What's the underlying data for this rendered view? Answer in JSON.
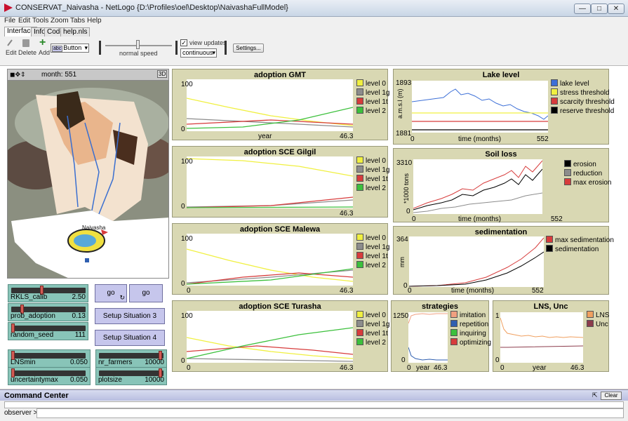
{
  "window": {
    "title": "CONSERVAT_Naivasha - NetLogo {D:\\Profiles\\oel\\Desktop\\NaivashaFullModel}"
  },
  "menu": [
    "File",
    "Edit",
    "Tools",
    "Zoom",
    "Tabs",
    "Help"
  ],
  "tabs": [
    "Interface",
    "Info",
    "Code",
    "help.nls"
  ],
  "toolbar": {
    "edit": "Edit",
    "delete": "Delete",
    "add": "Add",
    "widget": "Button",
    "speed": "normal speed",
    "view_updates": "view updates",
    "update_mode": "continuous",
    "settings": "Settings..."
  },
  "world": {
    "tick_label": "month: 551",
    "three_d": "3D",
    "place": "Naivasha"
  },
  "sliders": [
    {
      "name": "RKLS_calib",
      "value": "2.50",
      "fraction": 0.41
    },
    {
      "name": "prob_adoption",
      "value": "0.13",
      "fraction": 0.13
    },
    {
      "name": "random_seed",
      "value": "111",
      "fraction": 0.0
    },
    {
      "name": "LNSmin",
      "value": "0.050",
      "fraction": 0.0
    },
    {
      "name": "uncertaintymax",
      "value": "0.050",
      "fraction": 0.0
    },
    {
      "name": "nr_farmers",
      "value": "10000",
      "fraction": 0.98
    },
    {
      "name": "plotsize",
      "value": "10000",
      "fraction": 0.98
    }
  ],
  "buttons": {
    "go1": "go",
    "go2": "go",
    "setup3": "Setup Situation 3",
    "setup4": "Setup Situation 4"
  },
  "colors": {
    "l0": "#f0f040",
    "l1g": "#8c8c8c",
    "l1t": "#d73c3c",
    "l2": "#3cc03c",
    "lake": "#3c6fd7",
    "stress": "#f0f040",
    "scarcity": "#d73c3c",
    "reserve": "#000000",
    "erosion": "#000000",
    "reduction": "#8c8c8c",
    "max_erosion": "#d73c3c",
    "max_sed": "#d73c3c",
    "sed": "#000000",
    "imitation": "#f0a080",
    "repetition": "#2f5fb0",
    "inquiring": "#3cc03c",
    "optimizing": "#d73c3c",
    "lns": "#f0a060",
    "unc": "#8c3c4c"
  },
  "adoption": [
    {
      "title": "adoption GMT",
      "ymax": "100",
      "ymin": "0",
      "xmin": "",
      "xlabel": "year",
      "xmax": "46.3"
    },
    {
      "title": "adoption SCE Gilgil",
      "ymax": "100",
      "ymin": "0",
      "xmin": "",
      "xlabel": "",
      "xmax": "46.3"
    },
    {
      "title": "adoption SCE Malewa",
      "ymax": "100",
      "ymin": "0",
      "xmin": "0",
      "xlabel": "",
      "xmax": "46.3"
    },
    {
      "title": "adoption SCE Turasha",
      "ymax": "100",
      "ymin": "0",
      "xmin": "0",
      "xlabel": "",
      "xmax": "46.3"
    }
  ],
  "adoption_legend": [
    "level 0",
    "level 1g",
    "level 1t",
    "level 2"
  ],
  "lake": {
    "title": "Lake level",
    "ymax": "1893",
    "ymin": "1881",
    "ylabel": "a.m.s.l (m)",
    "xmin": "0",
    "xlabel": "time (months)",
    "xmax": "552",
    "legend": [
      "lake level",
      "stress threshold",
      "scarcity threshold",
      "reserve threshold"
    ]
  },
  "soil": {
    "title": "Soil loss",
    "ymax": "3310",
    "ymin": "0",
    "ylabel": "*1000 tons",
    "xmin": "0",
    "xlabel": "time (months)",
    "xmax": "552",
    "legend": [
      "erosion",
      "reduction",
      "max erosion"
    ]
  },
  "sed": {
    "title": "sedimentation",
    "ymax": "364",
    "ymin": "0",
    "ylabel": "mm",
    "xmin": "0",
    "xlabel": "time (months)",
    "xmax": "552",
    "legend": [
      "max sedimentation",
      "sedimentation"
    ]
  },
  "strat": {
    "title": "strategies",
    "ymax": "1250",
    "ymin": "0",
    "xmin": "0",
    "xlabel": "year",
    "xmax": "46.3",
    "legend": [
      "imitation",
      "repetition",
      "inquiring",
      "optimizing"
    ]
  },
  "lns": {
    "title": "LNS, Unc",
    "ymax": "1",
    "ymin": "0",
    "xmin": "0",
    "xlabel": "year",
    "xmax": "46.3",
    "legend": [
      "LNS",
      "Unc"
    ]
  },
  "command": {
    "title": "Command Center",
    "clear": "Clear",
    "prompt": "observer >"
  }
}
